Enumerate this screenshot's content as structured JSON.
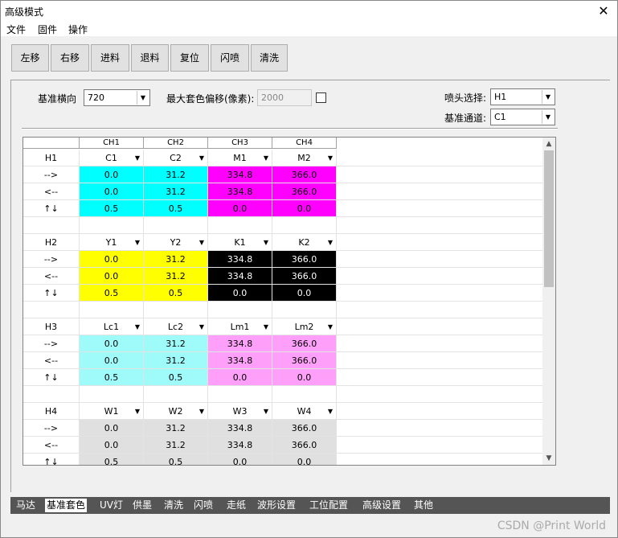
{
  "window": {
    "title": "高级模式",
    "close": "✕"
  },
  "menu": [
    "文件",
    "固件",
    "操作"
  ],
  "toolbar": [
    "左移",
    "右移",
    "进料",
    "退料",
    "复位",
    "闪喷",
    "清洗"
  ],
  "settings": {
    "base_h_label": "基准横向",
    "base_h_value": "720",
    "max_offset_label": "最大套色偏移(像素):",
    "max_offset_value": "2000",
    "nozzle_label": "喷头选择:",
    "nozzle_value": "H1",
    "channel_label": "基准通道:",
    "channel_value": "C1"
  },
  "grid": {
    "headers": [
      "",
      "CH1",
      "CH2",
      "CH3",
      "CH4"
    ],
    "row_labels": [
      "-->",
      "<--",
      "↑↓"
    ],
    "groups": [
      {
        "head": "H1",
        "channels": [
          "C1",
          "C2",
          "M1",
          "M2"
        ],
        "colors": [
          "#00ffff",
          "#00ffff",
          "#ff00ff",
          "#ff00ff"
        ],
        "text_colors": [
          "#000",
          "#000",
          "#000",
          "#000"
        ],
        "rows": [
          [
            "0.0",
            "31.2",
            "334.8",
            "366.0"
          ],
          [
            "0.0",
            "31.2",
            "334.8",
            "366.0"
          ],
          [
            "0.5",
            "0.5",
            "0.0",
            "0.0"
          ]
        ]
      },
      {
        "head": "H2",
        "channels": [
          "Y1",
          "Y2",
          "K1",
          "K2"
        ],
        "colors": [
          "#ffff00",
          "#ffff00",
          "#000000",
          "#000000"
        ],
        "text_colors": [
          "#000",
          "#000",
          "#fff",
          "#fff"
        ],
        "rows": [
          [
            "0.0",
            "31.2",
            "334.8",
            "366.0"
          ],
          [
            "0.0",
            "31.2",
            "334.8",
            "366.0"
          ],
          [
            "0.5",
            "0.5",
            "0.0",
            "0.0"
          ]
        ]
      },
      {
        "head": "H3",
        "channels": [
          "Lc1",
          "Lc2",
          "Lm1",
          "Lm2"
        ],
        "colors": [
          "#9ffafa",
          "#9ffafa",
          "#fe9ff9",
          "#fe9ff9"
        ],
        "text_colors": [
          "#000",
          "#000",
          "#000",
          "#000"
        ],
        "rows": [
          [
            "0.0",
            "31.2",
            "334.8",
            "366.0"
          ],
          [
            "0.0",
            "31.2",
            "334.8",
            "366.0"
          ],
          [
            "0.5",
            "0.5",
            "0.0",
            "0.0"
          ]
        ]
      },
      {
        "head": "H4",
        "channels": [
          "W1",
          "W2",
          "W3",
          "W4"
        ],
        "colors": [
          "#e0e0e0",
          "#e0e0e0",
          "#e0e0e0",
          "#e0e0e0"
        ],
        "text_colors": [
          "#000",
          "#000",
          "#000",
          "#000"
        ],
        "rows": [
          [
            "0.0",
            "31.2",
            "334.8",
            "366.0"
          ],
          [
            "0.0",
            "31.2",
            "334.8",
            "366.0"
          ],
          [
            "0.5",
            "0.5",
            "0.0",
            "0.0"
          ]
        ]
      }
    ]
  },
  "tabs": [
    "马达",
    "基准套色",
    "UV灯",
    "供墨",
    "清洗",
    "闪喷",
    "走纸",
    "波形设置",
    "工位配置",
    "高级设置",
    "其他"
  ],
  "active_tab": "基准套色",
  "watermark": "CSDN @Print World"
}
